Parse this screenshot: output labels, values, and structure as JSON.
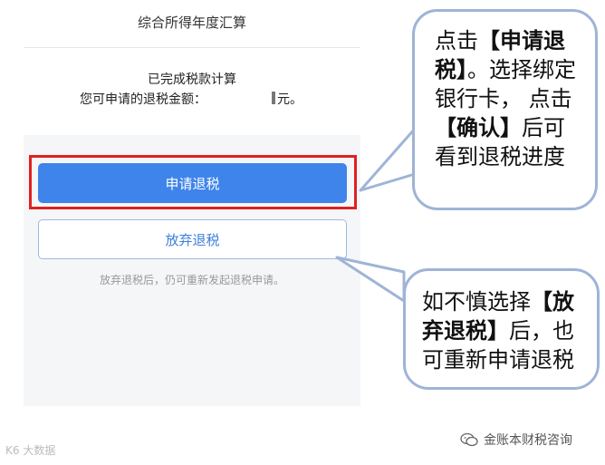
{
  "header": {
    "title": "综合所得年度汇算"
  },
  "info": {
    "line1": "已完成税款计算",
    "line2": "您可申请的退税金额：",
    "unit": "元。"
  },
  "buttons": {
    "apply": "申请退税",
    "abandon": "放弃退税"
  },
  "note": "放弃退税后，仍可重新发起退税申请。",
  "callout1": {
    "p1": "点击",
    "b1": "【申请退税】",
    "p2": "。选择绑定银行卡， 点击",
    "b2": "【确认】",
    "p3": "后可看到退税进度"
  },
  "callout2": {
    "p1": "如不慎选择",
    "b1": "【放弃退税】",
    "p2": "后，也可重新申请退税"
  },
  "footer": {
    "left": "K6 大数据",
    "right": "金账本财税咨询"
  },
  "colors": {
    "primary_button": "#3f84ea",
    "highlight_border": "#e02020",
    "callout_border": "#9fb4d6"
  }
}
